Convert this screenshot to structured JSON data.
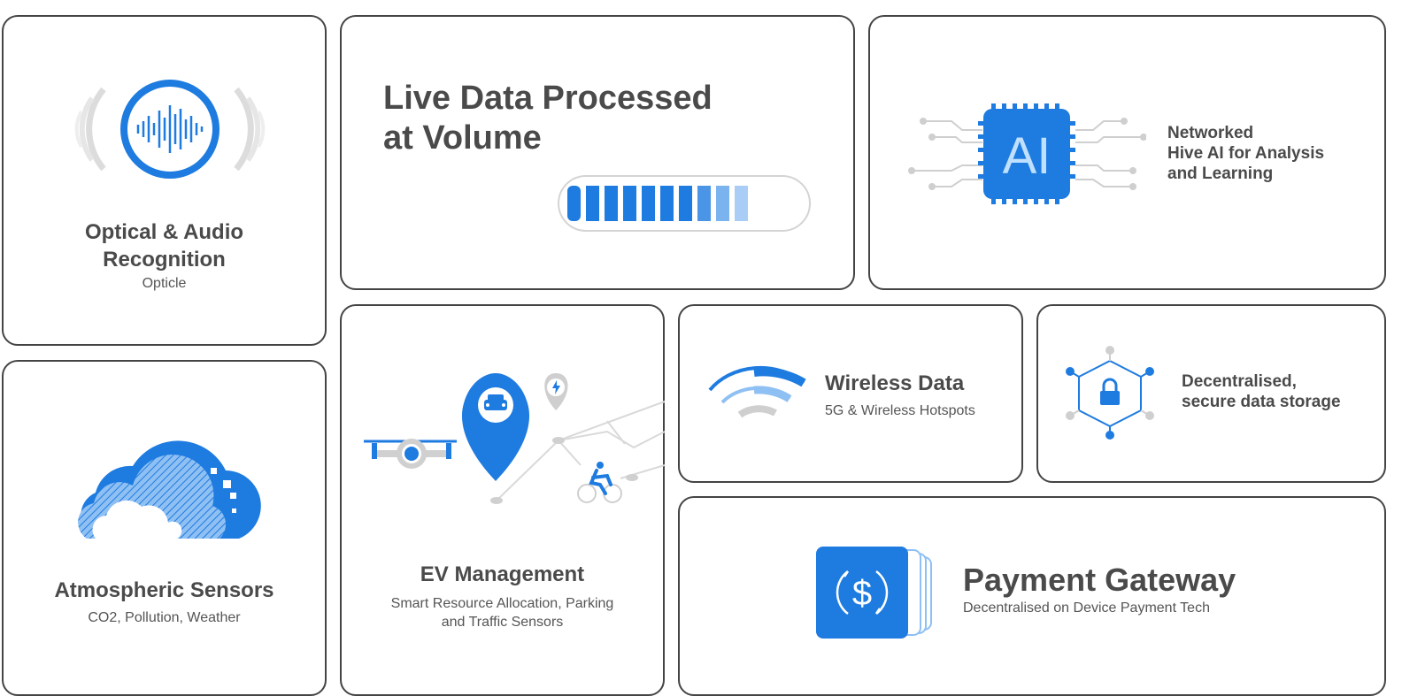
{
  "colors": {
    "accent": "#1e7be0",
    "accent_light": "#8fc0f3",
    "gray": "#cccccc",
    "text": "#4a4a4a",
    "border": "#444444"
  },
  "cards": {
    "optical": {
      "title_line1": "Optical & Audio",
      "title_line2": "Recognition",
      "subtitle": "Opticle",
      "icon": "sound-wave-icon"
    },
    "live_data": {
      "title_line1": "Live Data Processed",
      "title_line2": "at Volume",
      "icon": "progress-bar-icon",
      "progress_segments_total": 10,
      "progress_segments_solid": 7
    },
    "ai": {
      "chip_label": "AI",
      "line1": "Networked",
      "line2": "Hive AI for Analysis",
      "line3": "and Learning",
      "icon": "ai-chip-icon"
    },
    "atmospheric": {
      "title": "Atmospheric Sensors",
      "subtitle": "CO2, Pollution, Weather",
      "icon": "cloud-icon"
    },
    "ev": {
      "title": "EV Management",
      "subtitle_line1": "Smart Resource Allocation, Parking",
      "subtitle_line2": "and Traffic Sensors",
      "icon": "map-pin-car-icon"
    },
    "wireless": {
      "title": "Wireless Data",
      "subtitle": "5G & Wireless Hotspots",
      "icon": "wifi-icon"
    },
    "storage": {
      "line1": "Decentralised,",
      "line2": "secure data storage",
      "icon": "lock-network-icon"
    },
    "payment": {
      "title": "Payment Gateway",
      "subtitle": "Decentralised on Device Payment Tech",
      "icon": "dollar-card-icon"
    }
  }
}
